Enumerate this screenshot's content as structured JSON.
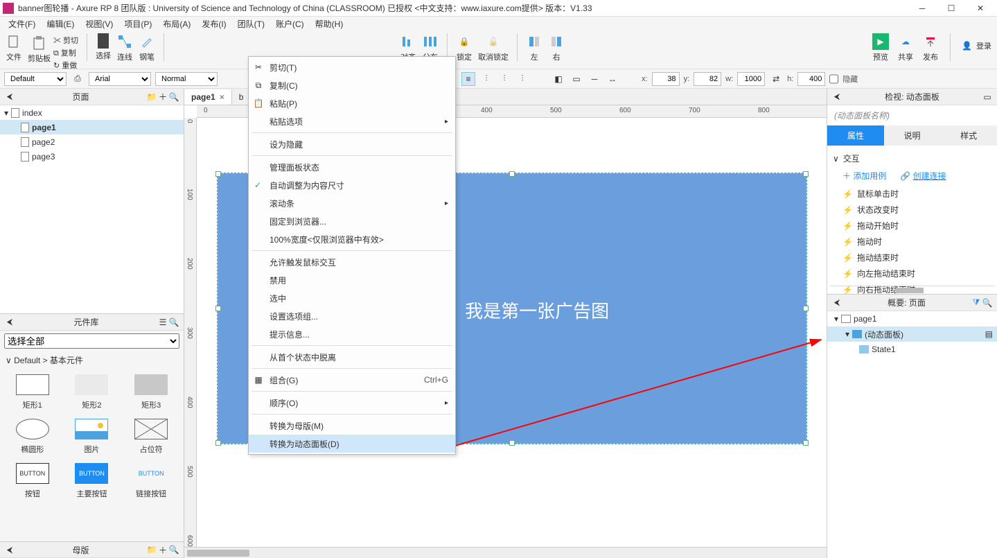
{
  "titlebar": {
    "title": "banner图轮播 - Axure RP 8 团队版 : University of Science and Technology of China (CLASSROOM) 已授权    <中文支持：www.iaxure.com提供> 版本：V1.33"
  },
  "menubar": {
    "items": [
      "文件(F)",
      "编辑(E)",
      "视图(V)",
      "项目(P)",
      "布局(A)",
      "发布(I)",
      "团队(T)",
      "账户(C)",
      "帮助(H)"
    ]
  },
  "toolbar": {
    "file": "文件",
    "clipboard": "剪贴板",
    "cut": "剪切",
    "copy": "复制",
    "paste": "重做",
    "select": "选择",
    "connect": "连线",
    "pen": "钢笔",
    "align": "对齐",
    "distribute": "分布",
    "lock": "锁定",
    "unlock": "取消锁定",
    "left_btn": "左",
    "right_btn": "右",
    "preview": "预览",
    "share": "共享",
    "publish": "发布",
    "login": "登录"
  },
  "fmtbar": {
    "style": "Default",
    "font": "Arial",
    "weight": "Normal",
    "x_lbl": "x:",
    "x": "38",
    "y_lbl": "y:",
    "y": "82",
    "w_lbl": "w:",
    "w": "1000",
    "h_lbl": "h:",
    "h": "400",
    "hidden": "隐藏"
  },
  "pages_panel": {
    "title": "页面",
    "items": [
      {
        "name": "index",
        "level": 0,
        "expand": true
      },
      {
        "name": "page1",
        "level": 1,
        "selected": true
      },
      {
        "name": "page2",
        "level": 1
      },
      {
        "name": "page3",
        "level": 1
      }
    ]
  },
  "widget_panel": {
    "title": "元件库",
    "select_all": "选择全部",
    "crumb_toggle": "∨",
    "crumb": "Default > 基本元件",
    "widgets": [
      {
        "name": "矩形1",
        "cls": "rect1"
      },
      {
        "name": "矩形2",
        "cls": "rect2"
      },
      {
        "name": "矩形3",
        "cls": "rect3"
      },
      {
        "name": "椭圆形",
        "cls": "ellipse"
      },
      {
        "name": "图片",
        "cls": "img"
      },
      {
        "name": "占位符",
        "cls": "ph"
      },
      {
        "name": "按钮",
        "cls": "btn1",
        "txt": "BUTTON"
      },
      {
        "name": "主要按钮",
        "cls": "btn2",
        "txt": "BUTTON"
      },
      {
        "name": "链接按钮",
        "cls": "btn3",
        "txt": "BUTTON"
      }
    ]
  },
  "masters_panel": {
    "title": "母版"
  },
  "tabs": {
    "active": "page1",
    "second": "b"
  },
  "canvas": {
    "text": "我是第一张广告图",
    "h_ticks": [
      {
        "v": "0",
        "p": 0
      },
      {
        "v": "400",
        "p": 400
      },
      {
        "v": "500",
        "p": 500
      },
      {
        "v": "600",
        "p": 600
      },
      {
        "v": "700",
        "p": 700
      },
      {
        "v": "800",
        "p": 800
      }
    ],
    "v_ticks": [
      {
        "v": "0",
        "p": 0
      },
      {
        "v": "100",
        "p": 100
      },
      {
        "v": "200",
        "p": 200
      },
      {
        "v": "300",
        "p": 300
      },
      {
        "v": "400",
        "p": 400
      },
      {
        "v": "500",
        "p": 500
      },
      {
        "v": "600",
        "p": 600
      }
    ]
  },
  "context_menu": {
    "items": [
      {
        "label": "剪切(T)",
        "ico": "✂"
      },
      {
        "label": "复制(C)",
        "ico": "⧉"
      },
      {
        "label": "粘贴(P)",
        "ico": "📋"
      },
      {
        "label": "粘贴选项",
        "arrow": true
      },
      {
        "sep": true
      },
      {
        "label": "设为隐藏"
      },
      {
        "sep": true
      },
      {
        "label": "管理面板状态"
      },
      {
        "label": "自动调整为内容尺寸",
        "check": true
      },
      {
        "label": "滚动条",
        "arrow": true
      },
      {
        "label": "固定到浏览器..."
      },
      {
        "label": "100%宽度<仅限浏览器中有效>"
      },
      {
        "sep": true
      },
      {
        "label": "允许触发鼠标交互"
      },
      {
        "label": "禁用"
      },
      {
        "label": "选中"
      },
      {
        "label": "设置选项组..."
      },
      {
        "label": "提示信息..."
      },
      {
        "sep": true
      },
      {
        "label": "从首个状态中脱离"
      },
      {
        "sep": true
      },
      {
        "label": "组合(G)",
        "shortcut": "Ctrl+G",
        "ico": "▦"
      },
      {
        "sep": true
      },
      {
        "label": "顺序(O)",
        "arrow": true
      },
      {
        "sep": true
      },
      {
        "label": "转换为母版(M)"
      },
      {
        "label": "转换为动态面板(D)",
        "selected": true
      }
    ]
  },
  "inspector": {
    "title": "检视: 动态面板",
    "name": "(动态面板名称)",
    "tabs": {
      "props": "属性",
      "notes": "说明",
      "style": "样式"
    },
    "inter_title": "交互",
    "add_case": "添加用例",
    "create_link": "创建连接",
    "events": [
      "鼠标单击时",
      "状态改变时",
      "拖动开始时",
      "拖动时",
      "拖动结束时",
      "向左拖动结束时",
      "向右拖动结束时"
    ]
  },
  "outline": {
    "title": "概要: 页面",
    "rows": [
      {
        "label": "page1",
        "level": 0,
        "ico": "page"
      },
      {
        "label": "(动态面板)",
        "level": 1,
        "ico": "dp",
        "selected": true
      },
      {
        "label": "State1",
        "level": 2,
        "ico": "state"
      }
    ]
  }
}
